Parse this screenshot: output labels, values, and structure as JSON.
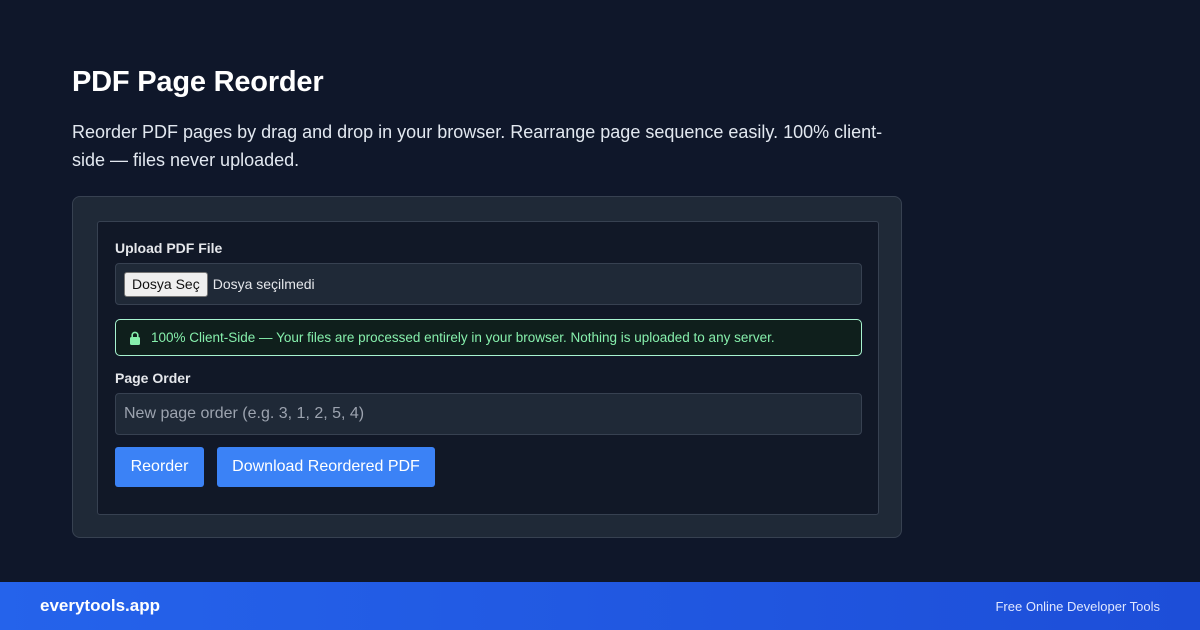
{
  "header": {
    "title": "PDF Page Reorder",
    "description": "Reorder PDF pages by drag and drop in your browser. Rearrange page sequence easily. 100% client-side — files never uploaded."
  },
  "upload": {
    "label": "Upload PDF File",
    "button_label": "Dosya Seç",
    "status": "Dosya seçilmedi"
  },
  "notice": {
    "icon": "lock-icon",
    "text": "100% Client-Side — Your files are processed entirely in your browser. Nothing is uploaded to any server.",
    "color": "#86efac"
  },
  "page_order": {
    "label": "Page Order",
    "placeholder": "New page order (e.g. 3, 1, 2, 5, 4)",
    "value": ""
  },
  "actions": {
    "reorder_label": "Reorder",
    "download_label": "Download Reordered PDF",
    "accent": "#3b82f6"
  },
  "footer": {
    "brand": "everytools.app",
    "tagline": "Free Online Developer Tools"
  }
}
